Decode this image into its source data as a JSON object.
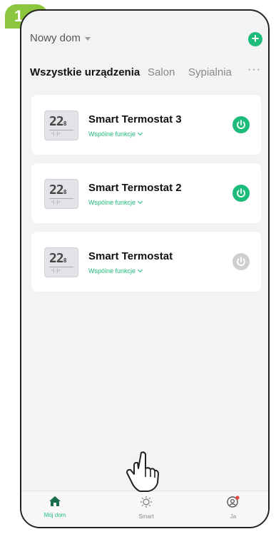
{
  "step_badge": "1",
  "header": {
    "home_name": "Nowy dom",
    "add_icon": "plus-icon"
  },
  "tabs": [
    {
      "label": "Wszystkie urządzenia",
      "active": true
    },
    {
      "label": "Salon",
      "active": false
    },
    {
      "label": "Sypialnia",
      "active": false
    }
  ],
  "tabs_more": "···",
  "devices": [
    {
      "name": "Smart Termostat 3",
      "function_label": "Wspólne funkcje",
      "power_on": true
    },
    {
      "name": "Smart Termostat 2",
      "function_label": "Wspólne funkcje",
      "power_on": true
    },
    {
      "name": "Smart Termostat",
      "function_label": "Wspólne funkcje",
      "power_on": false
    }
  ],
  "thermostat_display": "22",
  "bottom_nav": [
    {
      "label": "Mój dom",
      "icon": "home-icon",
      "active": true
    },
    {
      "label": "Smart",
      "icon": "sun-icon",
      "active": false
    },
    {
      "label": "Ja",
      "icon": "profile-icon",
      "active": false
    }
  ],
  "colors": {
    "accent": "#1ebc7b",
    "badge": "#8cc63f",
    "power_off": "#cfcfcf"
  }
}
